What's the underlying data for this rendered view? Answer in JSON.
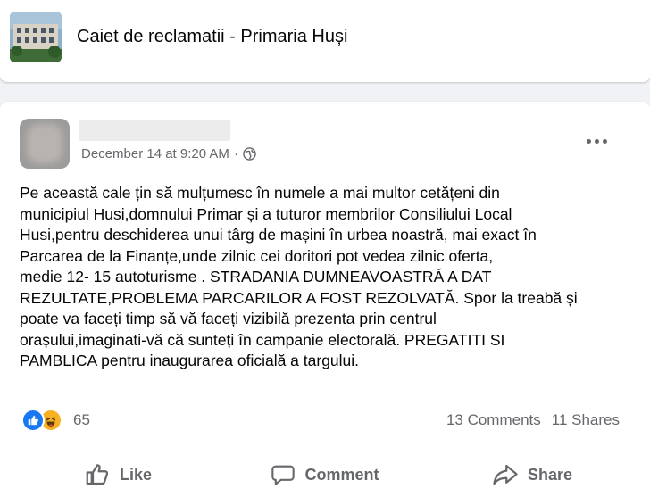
{
  "group": {
    "title": "Caiet de reclamatii - Primaria Huși"
  },
  "post": {
    "timestamp": "December 14 at 9:20 AM",
    "separator": "·",
    "privacy_icon": "globe-icon",
    "more_icon": "more-options-icon",
    "body_lines": [
      "Pe această  cale țin să  mulțumesc în numele a mai multor cetățeni  din",
      "municipiul Husi,domnului Primar și a tuturor membrilor  Consiliului Local",
      "Husi,pentru deschiderea  unui târg de mașini în urbea noastră,  mai exact în",
      "Parcarea de la Finanțe,unde zilnic  cei doritori pot vedea zilnic  oferta,",
      "medie 12- 15 autoturisme . STRADANIA DUMNEAVOASTRĂ  A DAT",
      "REZULTATE,PROBLEMA PARCARILOR A FOST REZOLVATĂ. Spor la treabă  și",
      "poate va faceți timp să  vă  faceți vizibilă  prezenta prin centrul",
      "orașului,imaginati-vă că   sunteți  în campanie electorală.  PREGATITI SI",
      "PAMBLICA pentru inaugurarea  oficială  a targului."
    ],
    "reactions": {
      "icons": [
        "like-reaction-icon",
        "haha-reaction-icon"
      ],
      "count": "65",
      "comments": "13 Comments",
      "shares": "11 Shares"
    },
    "actions": {
      "like": "Like",
      "comment": "Comment",
      "share": "Share"
    }
  },
  "colors": {
    "background": "#f0f2f5",
    "card": "#ffffff",
    "secondary_text": "#65676b",
    "like_blue": "#1877f2",
    "haha_yellow": "#f7b125"
  }
}
